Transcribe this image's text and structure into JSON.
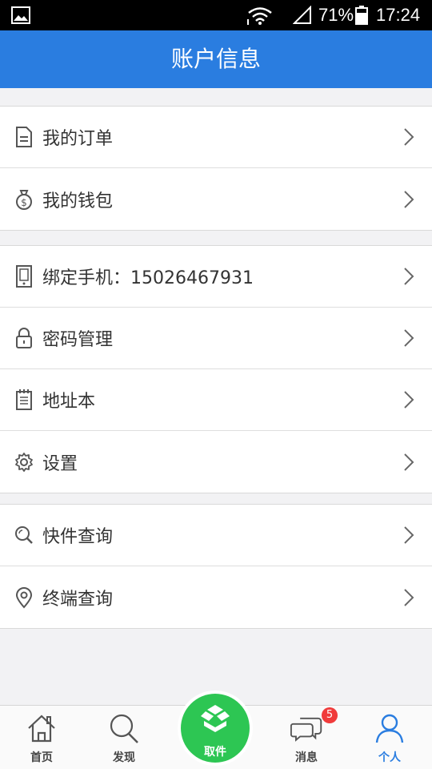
{
  "status_bar": {
    "battery": "71%",
    "time": "17:24"
  },
  "header": {
    "title": "账户信息"
  },
  "groups": [
    {
      "items": [
        {
          "label": "我的订单",
          "icon": "document-icon"
        },
        {
          "label": "我的钱包",
          "icon": "money-bag-icon"
        }
      ]
    },
    {
      "items": [
        {
          "label": "绑定手机：15026467931",
          "icon": "phone-icon"
        },
        {
          "label": "密码管理",
          "icon": "lock-icon"
        },
        {
          "label": "地址本",
          "icon": "notebook-icon"
        },
        {
          "label": "设置",
          "icon": "gear-icon"
        }
      ]
    },
    {
      "items": [
        {
          "label": "快件查询",
          "icon": "search-icon"
        },
        {
          "label": "终端查询",
          "icon": "location-pin-icon"
        }
      ]
    }
  ],
  "tabs": {
    "home": "首页",
    "discover": "发现",
    "pickup": "取件",
    "messages": "消息",
    "profile": "个人",
    "messages_badge": "5"
  },
  "colors": {
    "accent": "#2a7de0",
    "pickup": "#2dc653",
    "badge": "#f03b3b"
  }
}
